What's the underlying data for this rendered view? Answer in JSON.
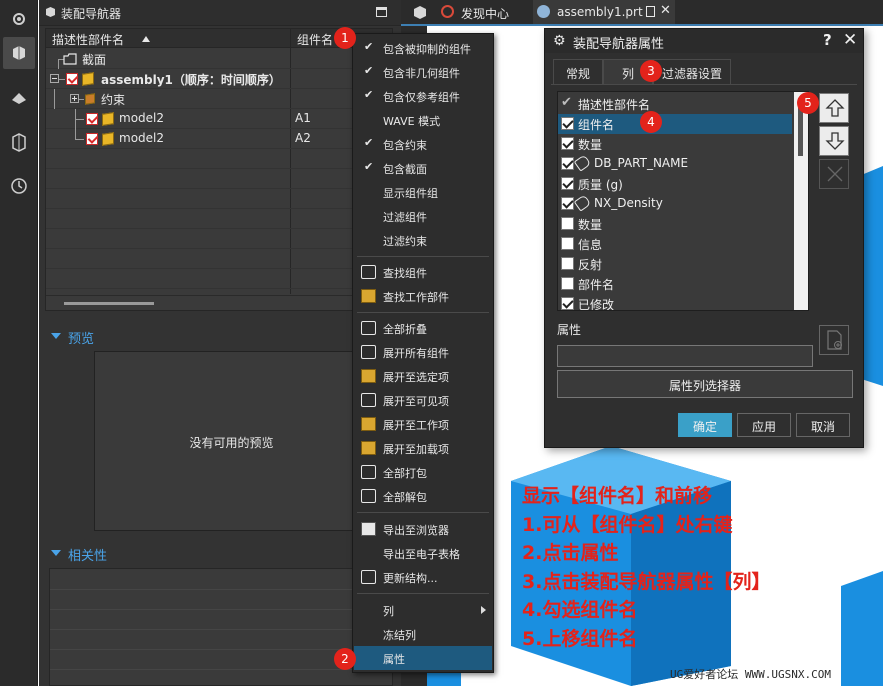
{
  "navigator": {
    "title": "装配导航器",
    "columns": [
      "描述性部件名",
      "组件名"
    ],
    "rows": [
      {
        "label": "截面",
        "col2": ""
      },
      {
        "label": "assembly1（顺序：时间顺序）",
        "col2": ""
      },
      {
        "label": "约束",
        "col2": ""
      },
      {
        "label": "model2",
        "col2": "A1"
      },
      {
        "label": "model2",
        "col2": "A2"
      }
    ],
    "preview_title": "预览",
    "preview_empty": "没有可用的预览",
    "related_title": "相关性"
  },
  "context_menu": {
    "items": [
      {
        "label": "包含被抑制的组件",
        "checked": true
      },
      {
        "label": "包含非几何组件",
        "checked": true
      },
      {
        "label": "包含仅参考组件",
        "checked": true
      },
      {
        "label": "WAVE 模式",
        "checked": false
      },
      {
        "label": "包含约束",
        "checked": true
      },
      {
        "label": "包含截面",
        "checked": true
      },
      {
        "label": "显示组件组",
        "checked": false
      },
      {
        "label": "过滤组件",
        "checked": false
      },
      {
        "label": "过滤约束",
        "checked": false
      },
      {
        "label": "查找组件",
        "icon": "find-component-icon"
      },
      {
        "label": "查找工作部件",
        "icon": "find-work-part-icon"
      },
      {
        "label": "全部折叠",
        "icon": "collapse-all-icon"
      },
      {
        "label": "展开所有组件",
        "icon": "expand-all-icon"
      },
      {
        "label": "展开至选定项",
        "icon": "expand-to-selected-icon"
      },
      {
        "label": "展开至可见项",
        "icon": "expand-to-visible-icon"
      },
      {
        "label": "展开至工作项",
        "icon": "expand-to-work-icon"
      },
      {
        "label": "展开至加载项",
        "icon": "expand-to-loaded-icon"
      },
      {
        "label": "全部打包",
        "icon": "pack-all-icon"
      },
      {
        "label": "全部解包",
        "icon": "unpack-all-icon"
      },
      {
        "label": "导出至浏览器",
        "icon": "export-browser-icon"
      },
      {
        "label": "导出至电子表格",
        "icon": ""
      },
      {
        "label": "更新结构...",
        "icon": "update-structure-icon"
      },
      {
        "label": "列",
        "submenu": true
      },
      {
        "label": "冻结列"
      },
      {
        "label": "属性",
        "highlighted": true
      }
    ]
  },
  "tabs": [
    {
      "label": "发现中心"
    },
    {
      "label": "assembly1.prt"
    }
  ],
  "dialog": {
    "title": "装配导航器属性",
    "help": "?",
    "close": "✕",
    "tabs": [
      "常规",
      "列",
      "过滤器设置"
    ],
    "columns_list": [
      {
        "label": "描述性部件名",
        "type": "fixed"
      },
      {
        "label": "组件名",
        "checked": true,
        "selected": true
      },
      {
        "label": "数量",
        "checked": true
      },
      {
        "label": "DB_PART_NAME",
        "checked": true,
        "tag": true
      },
      {
        "label": "质量 (g)",
        "checked": true
      },
      {
        "label": "NX_Density",
        "checked": true,
        "tag": true
      },
      {
        "label": "数量",
        "checked": false
      },
      {
        "label": "信息",
        "checked": false
      },
      {
        "label": "反射",
        "checked": false
      },
      {
        "label": "部件名",
        "checked": false
      },
      {
        "label": "已修改",
        "checked": true
      }
    ],
    "attr_label": "属性",
    "prop_selector": "属性列选择器",
    "ok": "确定",
    "apply": "应用",
    "cancel": "取消"
  },
  "annotation": {
    "title": "显示【组件名】和前移",
    "steps": [
      "1.可从【组件名】处右键",
      "2.点击属性",
      "3.点击装配导航器属性【列】",
      "4.勾选组件名",
      "5.上移组件名"
    ]
  },
  "badges": [
    "1",
    "2",
    "3",
    "4",
    "5"
  ],
  "watermark": "UG爱好者论坛 WWW.UGSNX.COM",
  "colors": {
    "accent": "#1e5a7f",
    "annotation": "#e3231b",
    "primary_button": "#3aa0c8",
    "section_title": "#4aa3e8",
    "cube": "#1a8fe0"
  }
}
